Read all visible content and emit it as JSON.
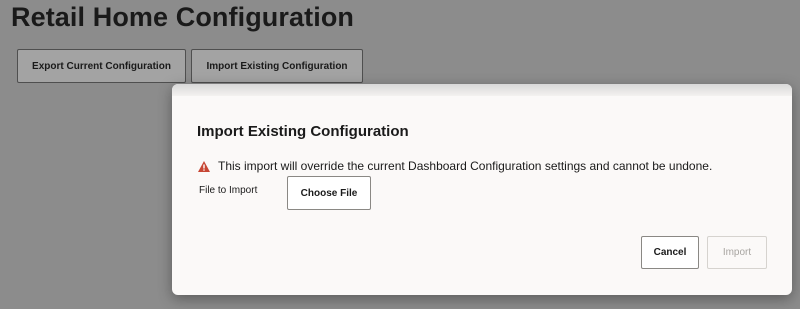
{
  "page": {
    "title": "Retail Home Configuration"
  },
  "toolbar": {
    "export_label": "Export Current Configuration",
    "import_label": "Import Existing Configuration"
  },
  "dialog": {
    "title": "Import Existing Configuration",
    "warning_icon": "warning-triangle-icon",
    "warning_text": "This import will override the current Dashboard Configuration settings and cannot be undone.",
    "file_label": "File to Import",
    "choose_file_label": "Choose File",
    "cancel_label": "Cancel",
    "import_label": "Import",
    "import_disabled": true
  },
  "colors": {
    "overlay": "#8c8c8c",
    "dialog_bg": "#fbf9f8",
    "warning": "#c74634"
  }
}
